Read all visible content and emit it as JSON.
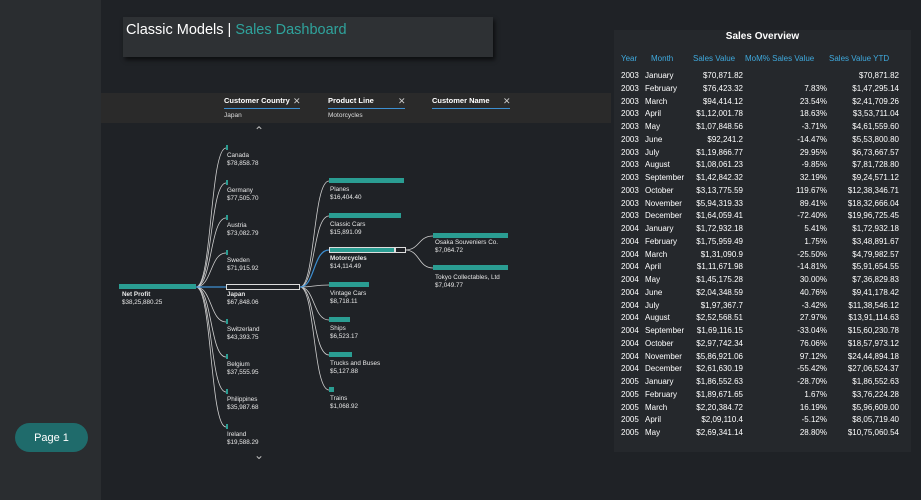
{
  "page_nav": {
    "page1_label": "Page 1"
  },
  "title": {
    "main": "Classic Models",
    "separator": " | ",
    "sub": "Sales Dashboard"
  },
  "tree": {
    "levels": [
      {
        "name": "Customer Country",
        "selected": "Japan"
      },
      {
        "name": "Product Line",
        "selected": "Motorcycles"
      },
      {
        "name": "Customer Name",
        "selected": ""
      }
    ],
    "root": {
      "name": "Net Profit",
      "value": "$38,25,880.25"
    },
    "countries": [
      {
        "name": "Canada",
        "value": "$78,858.78"
      },
      {
        "name": "Germany",
        "value": "$77,505.70"
      },
      {
        "name": "Austria",
        "value": "$73,082.79"
      },
      {
        "name": "Sweden",
        "value": "$71,915.92"
      },
      {
        "name": "Japan",
        "value": "$67,848.06"
      },
      {
        "name": "Switzerland",
        "value": "$43,393.75"
      },
      {
        "name": "Belgium",
        "value": "$37,555.95"
      },
      {
        "name": "Philippines",
        "value": "$35,987.68"
      },
      {
        "name": "Ireland",
        "value": "$19,588.29"
      }
    ],
    "products": [
      {
        "name": "Planes",
        "value": "$16,404.40"
      },
      {
        "name": "Classic Cars",
        "value": "$15,891.09"
      },
      {
        "name": "Motorcycles",
        "value": "$14,114.49"
      },
      {
        "name": "Vintage Cars",
        "value": "$8,718.11"
      },
      {
        "name": "Ships",
        "value": "$6,523.17"
      },
      {
        "name": "Trucks and Buses",
        "value": "$5,127.88"
      },
      {
        "name": "Trains",
        "value": "$1,068.92"
      }
    ],
    "customers": [
      {
        "name": "Osaka Souveniers Co.",
        "value": "$7,064.72"
      },
      {
        "name": "Tokyo Collectables, Ltd",
        "value": "$7,049.77"
      }
    ]
  },
  "table": {
    "title": "Sales Overview",
    "headers": [
      "Year",
      "Month",
      "Sales Value",
      "MoM% Sales Value",
      "Sales Value YTD"
    ],
    "rows": [
      [
        "2003",
        "January",
        "$70,871.82",
        "",
        "$70,871.82"
      ],
      [
        "2003",
        "February",
        "$76,423.32",
        "7.83%",
        "$1,47,295.14"
      ],
      [
        "2003",
        "March",
        "$94,414.12",
        "23.54%",
        "$2,41,709.26"
      ],
      [
        "2003",
        "April",
        "$1,12,001.78",
        "18.63%",
        "$3,53,711.04"
      ],
      [
        "2003",
        "May",
        "$1,07,848.56",
        "-3.71%",
        "$4,61,559.60"
      ],
      [
        "2003",
        "June",
        "$92,241.2",
        "-14.47%",
        "$5,53,800.80"
      ],
      [
        "2003",
        "July",
        "$1,19,866.77",
        "29.95%",
        "$6,73,667.57"
      ],
      [
        "2003",
        "August",
        "$1,08,061.23",
        "-9.85%",
        "$7,81,728.80"
      ],
      [
        "2003",
        "September",
        "$1,42,842.32",
        "32.19%",
        "$9,24,571.12"
      ],
      [
        "2003",
        "October",
        "$3,13,775.59",
        "119.67%",
        "$12,38,346.71"
      ],
      [
        "2003",
        "November",
        "$5,94,319.33",
        "89.41%",
        "$18,32,666.04"
      ],
      [
        "2003",
        "December",
        "$1,64,059.41",
        "-72.40%",
        "$19,96,725.45"
      ],
      [
        "2004",
        "January",
        "$1,72,932.18",
        "5.41%",
        "$1,72,932.18"
      ],
      [
        "2004",
        "February",
        "$1,75,959.49",
        "1.75%",
        "$3,48,891.67"
      ],
      [
        "2004",
        "March",
        "$1,31,090.9",
        "-25.50%",
        "$4,79,982.57"
      ],
      [
        "2004",
        "April",
        "$1,11,671.98",
        "-14.81%",
        "$5,91,654.55"
      ],
      [
        "2004",
        "May",
        "$1,45,175.28",
        "30.00%",
        "$7,36,829.83"
      ],
      [
        "2004",
        "June",
        "$2,04,348.59",
        "40.76%",
        "$9,41,178.42"
      ],
      [
        "2004",
        "July",
        "$1,97,367.7",
        "-3.42%",
        "$11,38,546.12"
      ],
      [
        "2004",
        "August",
        "$2,52,568.51",
        "27.97%",
        "$13,91,114.63"
      ],
      [
        "2004",
        "September",
        "$1,69,116.15",
        "-33.04%",
        "$15,60,230.78"
      ],
      [
        "2004",
        "October",
        "$2,97,742.34",
        "76.06%",
        "$18,57,973.12"
      ],
      [
        "2004",
        "November",
        "$5,86,921.06",
        "97.12%",
        "$24,44,894.18"
      ],
      [
        "2004",
        "December",
        "$2,61,630.19",
        "-55.42%",
        "$27,06,524.37"
      ],
      [
        "2005",
        "January",
        "$1,86,552.63",
        "-28.70%",
        "$1,86,552.63"
      ],
      [
        "2005",
        "February",
        "$1,89,671.65",
        "1.67%",
        "$3,76,224.28"
      ],
      [
        "2005",
        "March",
        "$2,20,384.72",
        "16.19%",
        "$5,96,609.00"
      ],
      [
        "2005",
        "April",
        "$2,09,110.4",
        "-5.12%",
        "$8,05,719.40"
      ],
      [
        "2005",
        "May",
        "$2,69,341.14",
        "28.80%",
        "$10,75,060.54"
      ]
    ]
  }
}
